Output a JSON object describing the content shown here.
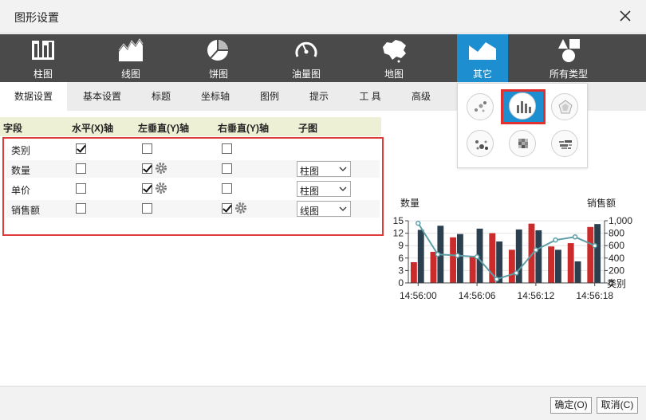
{
  "dialog": {
    "title": "图形设置"
  },
  "chart_types": [
    {
      "label": "柱图",
      "icon": "column-chart-icon"
    },
    {
      "label": "线图",
      "icon": "line-chart-icon"
    },
    {
      "label": "饼图",
      "icon": "pie-chart-icon"
    },
    {
      "label": "油量图",
      "icon": "gauge-icon"
    },
    {
      "label": "地图",
      "icon": "map-icon"
    },
    {
      "label": "其它",
      "icon": "other-chart-icon"
    },
    {
      "label": "所有类型",
      "icon": "all-types-icon"
    }
  ],
  "active_chart_type": "其它",
  "tabs": [
    "数据设置",
    "基本设置",
    "标题",
    "坐标轴",
    "图例",
    "提示",
    "工 具",
    "高级"
  ],
  "active_tab": "数据设置",
  "subtype_popup": [
    {
      "icon": "scatter-icon"
    },
    {
      "icon": "column-line-combo-icon",
      "selected": true
    },
    {
      "icon": "radar-icon"
    },
    {
      "icon": "bubble-icon"
    },
    {
      "icon": "heatmap-icon"
    },
    {
      "icon": "word-cloud-icon"
    }
  ],
  "field_table": {
    "headers": [
      "字段",
      "水平(X)轴",
      "左垂直(Y)轴",
      "右垂直(Y)轴",
      "子图"
    ],
    "rows": [
      {
        "field": "类别",
        "x": true,
        "left_y": false,
        "right_y": false,
        "subtype": ""
      },
      {
        "field": "数量",
        "x": false,
        "left_y": true,
        "right_y": false,
        "subtype": "柱图"
      },
      {
        "field": "单价",
        "x": false,
        "left_y": true,
        "right_y": false,
        "subtype": "柱图"
      },
      {
        "field": "销售额",
        "x": false,
        "left_y": false,
        "right_y": true,
        "subtype": "线图"
      }
    ]
  },
  "chart_data": {
    "type": "bar",
    "left_axis_title": "数量",
    "right_axis_title": "销售额",
    "x_axis_title": "类别",
    "left_ticks": [
      "0",
      "3",
      "6",
      "9",
      "12",
      "15"
    ],
    "right_ticks": [
      "0",
      "200",
      "400",
      "600",
      "800",
      "1,000"
    ],
    "x_tick_labels": [
      "14:56:00",
      "14:56:06",
      "14:56:12",
      "14:56:18"
    ],
    "ylim_left": [
      0,
      15
    ],
    "ylim_right": [
      0,
      1000
    ],
    "series": [
      {
        "name": "数量",
        "color": "#cc2b2b",
        "values": [
          5,
          7.5,
          11,
          6.5,
          12,
          8,
          14.3,
          8.8,
          9.6,
          13.5
        ]
      },
      {
        "name": "单价",
        "color": "#2b3f4f",
        "values": [
          12.8,
          13.8,
          11.8,
          13.1,
          10,
          12.9,
          12.7,
          8,
          5.2,
          14.2
        ]
      },
      {
        "name": "销售额",
        "color": "#5e9ea6",
        "values": [
          960,
          460,
          440,
          420,
          60,
          160,
          530,
          690,
          740,
          600
        ]
      }
    ]
  },
  "footer": {
    "ok": "确定(O)",
    "cancel": "取消(C)"
  }
}
